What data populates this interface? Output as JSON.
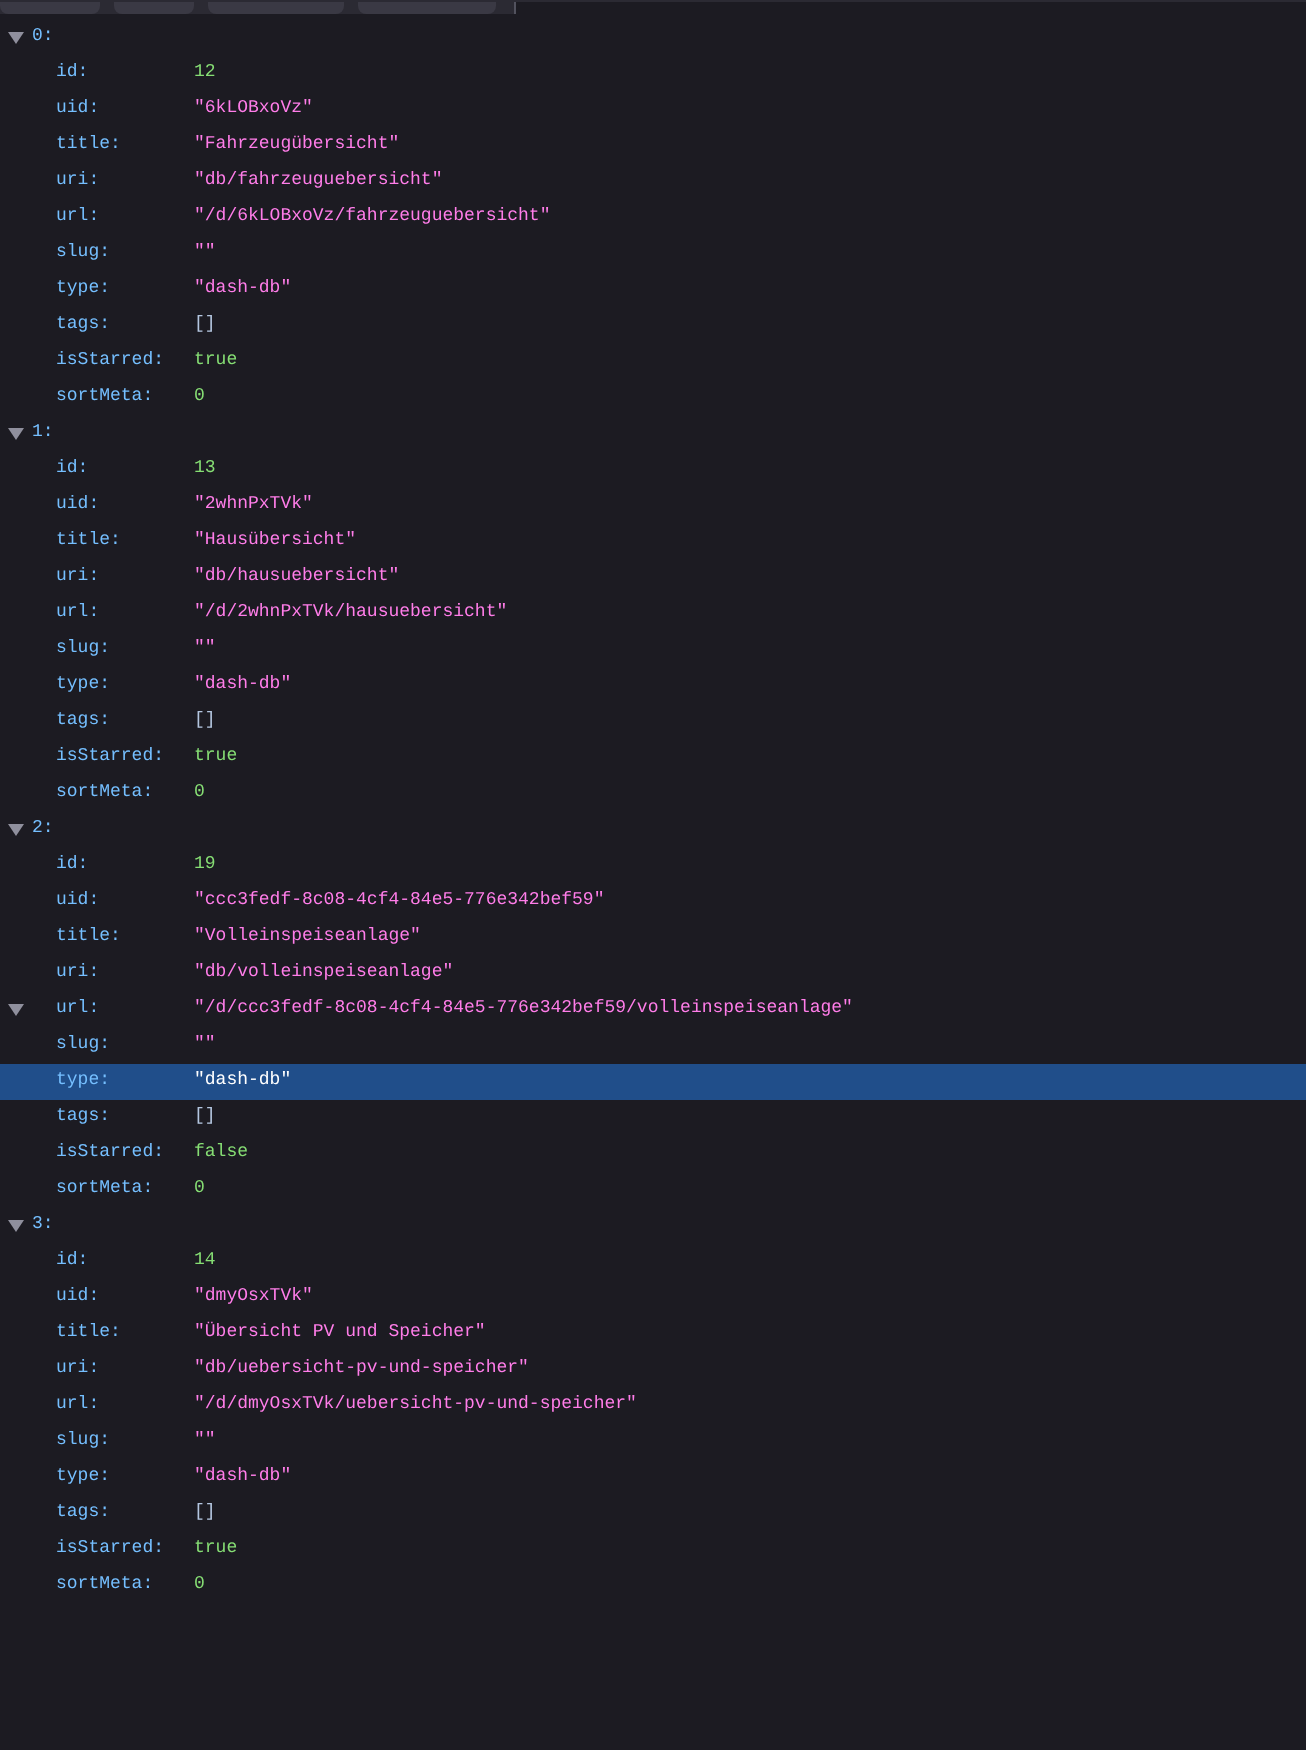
{
  "toolbar": {
    "tabs": [
      {
        "selected": false
      },
      {
        "selected": false
      },
      {
        "selected": false
      },
      {
        "selected": false
      }
    ]
  },
  "items": [
    {
      "index": "0:",
      "expanded": true,
      "fields": [
        {
          "key": "id:",
          "value": "12",
          "kind": "number",
          "selected": false,
          "toggle": false
        },
        {
          "key": "uid:",
          "value": "\"6kLOBxoVz\"",
          "kind": "string",
          "selected": false,
          "toggle": false
        },
        {
          "key": "title:",
          "value": "\"Fahrzeugübersicht\"",
          "kind": "string",
          "selected": false,
          "toggle": false
        },
        {
          "key": "uri:",
          "value": "\"db/fahrzeuguebersicht\"",
          "kind": "string",
          "selected": false,
          "toggle": false
        },
        {
          "key": "url:",
          "value": "\"/d/6kLOBxoVz/fahrzeuguebersicht\"",
          "kind": "string",
          "selected": false,
          "toggle": false
        },
        {
          "key": "slug:",
          "value": "\"\"",
          "kind": "string",
          "selected": false,
          "toggle": false
        },
        {
          "key": "type:",
          "value": "\"dash-db\"",
          "kind": "string",
          "selected": false,
          "toggle": false
        },
        {
          "key": "tags:",
          "value": "[]",
          "kind": "array",
          "selected": false,
          "toggle": false
        },
        {
          "key": "isStarred:",
          "value": "true",
          "kind": "boolean",
          "selected": false,
          "toggle": false
        },
        {
          "key": "sortMeta:",
          "value": "0",
          "kind": "number",
          "selected": false,
          "toggle": false
        }
      ]
    },
    {
      "index": "1:",
      "expanded": true,
      "fields": [
        {
          "key": "id:",
          "value": "13",
          "kind": "number",
          "selected": false,
          "toggle": false
        },
        {
          "key": "uid:",
          "value": "\"2whnPxTVk\"",
          "kind": "string",
          "selected": false,
          "toggle": false
        },
        {
          "key": "title:",
          "value": "\"Hausübersicht\"",
          "kind": "string",
          "selected": false,
          "toggle": false
        },
        {
          "key": "uri:",
          "value": "\"db/hausuebersicht\"",
          "kind": "string",
          "selected": false,
          "toggle": false
        },
        {
          "key": "url:",
          "value": "\"/d/2whnPxTVk/hausuebersicht\"",
          "kind": "string",
          "selected": false,
          "toggle": false
        },
        {
          "key": "slug:",
          "value": "\"\"",
          "kind": "string",
          "selected": false,
          "toggle": false
        },
        {
          "key": "type:",
          "value": "\"dash-db\"",
          "kind": "string",
          "selected": false,
          "toggle": false
        },
        {
          "key": "tags:",
          "value": "[]",
          "kind": "array",
          "selected": false,
          "toggle": false
        },
        {
          "key": "isStarred:",
          "value": "true",
          "kind": "boolean",
          "selected": false,
          "toggle": false
        },
        {
          "key": "sortMeta:",
          "value": "0",
          "kind": "number",
          "selected": false,
          "toggle": false
        }
      ]
    },
    {
      "index": "2:",
      "expanded": true,
      "fields": [
        {
          "key": "id:",
          "value": "19",
          "kind": "number",
          "selected": false,
          "toggle": false
        },
        {
          "key": "uid:",
          "value": "\"ccc3fedf-8c08-4cf4-84e5-776e342bef59\"",
          "kind": "string",
          "selected": false,
          "toggle": false
        },
        {
          "key": "title:",
          "value": "\"Volleinspeiseanlage\"",
          "kind": "string",
          "selected": false,
          "toggle": false
        },
        {
          "key": "uri:",
          "value": "\"db/volleinspeiseanlage\"",
          "kind": "string",
          "selected": false,
          "toggle": false
        },
        {
          "key": "url:",
          "value": "\"/d/ccc3fedf-8c08-4cf4-84e5-776e342bef59/volleinspeiseanlage\"",
          "kind": "string",
          "selected": false,
          "toggle": true
        },
        {
          "key": "slug:",
          "value": "\"\"",
          "kind": "string",
          "selected": false,
          "toggle": false
        },
        {
          "key": "type:",
          "value": "\"dash-db\"",
          "kind": "string",
          "selected": true,
          "toggle": false
        },
        {
          "key": "tags:",
          "value": "[]",
          "kind": "array",
          "selected": false,
          "toggle": false
        },
        {
          "key": "isStarred:",
          "value": "false",
          "kind": "boolean",
          "selected": false,
          "toggle": false
        },
        {
          "key": "sortMeta:",
          "value": "0",
          "kind": "number",
          "selected": false,
          "toggle": false
        }
      ]
    },
    {
      "index": "3:",
      "expanded": true,
      "fields": [
        {
          "key": "id:",
          "value": "14",
          "kind": "number",
          "selected": false,
          "toggle": false
        },
        {
          "key": "uid:",
          "value": "\"dmyOsxTVk\"",
          "kind": "string",
          "selected": false,
          "toggle": false
        },
        {
          "key": "title:",
          "value": "\"Übersicht PV und Speicher\"",
          "kind": "string",
          "selected": false,
          "toggle": false
        },
        {
          "key": "uri:",
          "value": "\"db/uebersicht-pv-und-speicher\"",
          "kind": "string",
          "selected": false,
          "toggle": false
        },
        {
          "key": "url:",
          "value": "\"/d/dmyOsxTVk/uebersicht-pv-und-speicher\"",
          "kind": "string",
          "selected": false,
          "toggle": false
        },
        {
          "key": "slug:",
          "value": "\"\"",
          "kind": "string",
          "selected": false,
          "toggle": false
        },
        {
          "key": "type:",
          "value": "\"dash-db\"",
          "kind": "string",
          "selected": false,
          "toggle": false
        },
        {
          "key": "tags:",
          "value": "[]",
          "kind": "array",
          "selected": false,
          "toggle": false
        },
        {
          "key": "isStarred:",
          "value": "true",
          "kind": "boolean",
          "selected": false,
          "toggle": false
        },
        {
          "key": "sortMeta:",
          "value": "0",
          "kind": "number",
          "selected": false,
          "toggle": false
        }
      ]
    }
  ]
}
